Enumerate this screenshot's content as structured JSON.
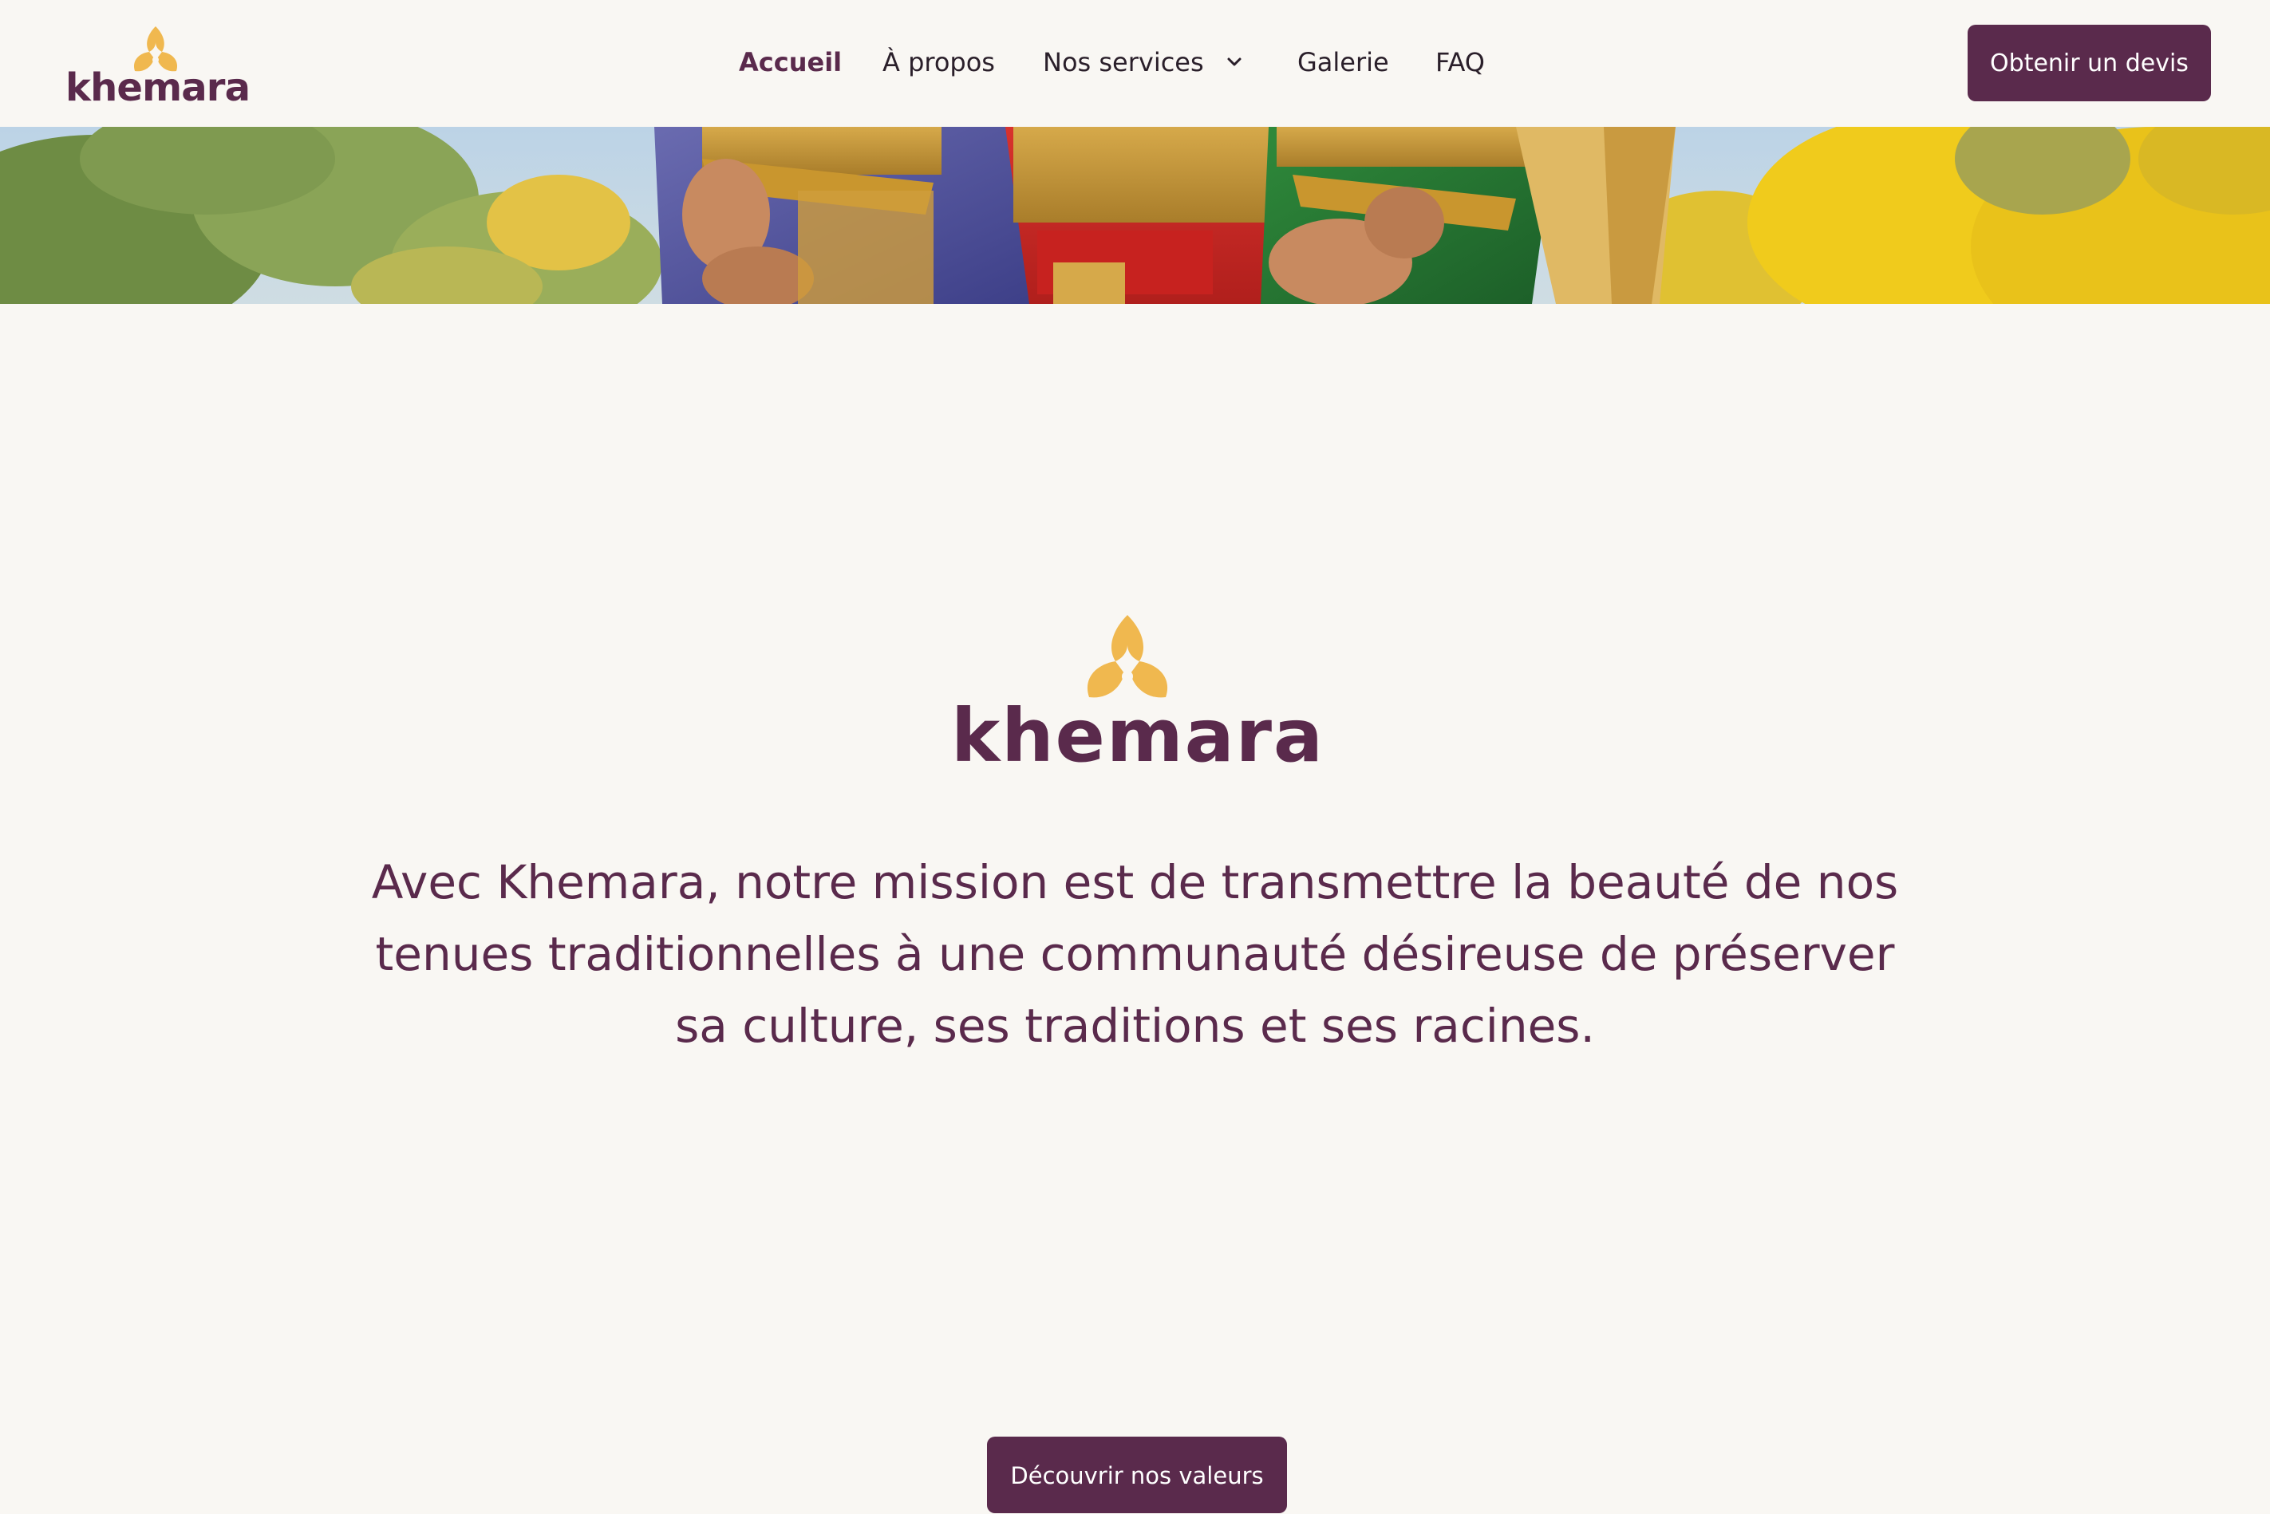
{
  "brand": {
    "name": "khemara",
    "primary_color": "#5a2a4c",
    "accent_color": "#f0b84f"
  },
  "nav": {
    "items": [
      {
        "label": "Accueil",
        "active": true
      },
      {
        "label": "À propos",
        "active": false
      },
      {
        "label": "Nos services",
        "active": false,
        "icon": "chevron-down-icon"
      },
      {
        "label": "Galerie",
        "active": false
      },
      {
        "label": "FAQ",
        "active": false
      }
    ]
  },
  "header": {
    "cta_label": "Obtenir un devis"
  },
  "mission": {
    "logo_text": "khemara",
    "text": "Avec Khemara, notre mission est de transmettre la beauté de nos tenues traditionnelles à une communauté désireuse de préserver sa culture, ses traditions et ses racines.",
    "cta_label": "Découvrir nos valeurs"
  }
}
